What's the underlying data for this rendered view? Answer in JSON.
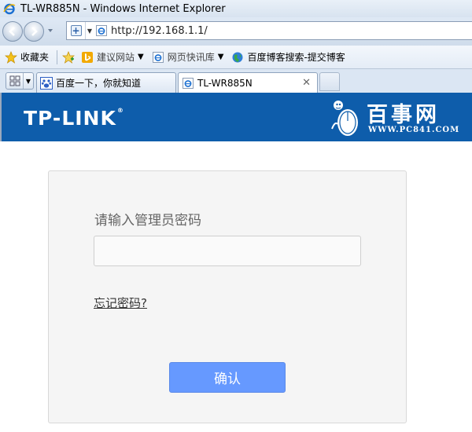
{
  "window": {
    "title": "TL-WR885N - Windows Internet Explorer"
  },
  "address_bar": {
    "url": "http://192.168.1.1/"
  },
  "favorites_bar": {
    "favorites_label": "收藏夹",
    "items": [
      {
        "label": "建议网站",
        "icon": "bing-icon"
      },
      {
        "label": "网页快讯库",
        "icon": "ie-page-icon"
      },
      {
        "label": "百度博客搜索-提交博客",
        "icon": "globe-icon"
      }
    ]
  },
  "tabs": [
    {
      "label": "百度一下，你就知道",
      "icon": "baidu-paw-icon",
      "active": false
    },
    {
      "label": "TL-WR885N",
      "icon": "ie-page-icon",
      "active": true,
      "close": "✕"
    }
  ],
  "header": {
    "brand": "TP-LINK",
    "brand_mark": "®",
    "watermark_cn": "百事网",
    "watermark_en": "WWW.PC841.COM"
  },
  "login": {
    "password_label": "请输入管理员密码",
    "password_value": "",
    "forgot_link": "忘记密码?",
    "confirm_button": "确认"
  },
  "colors": {
    "header_bg": "#0e5dab",
    "button_bg": "#6699ff",
    "panel_bg": "#f5f5f5"
  }
}
